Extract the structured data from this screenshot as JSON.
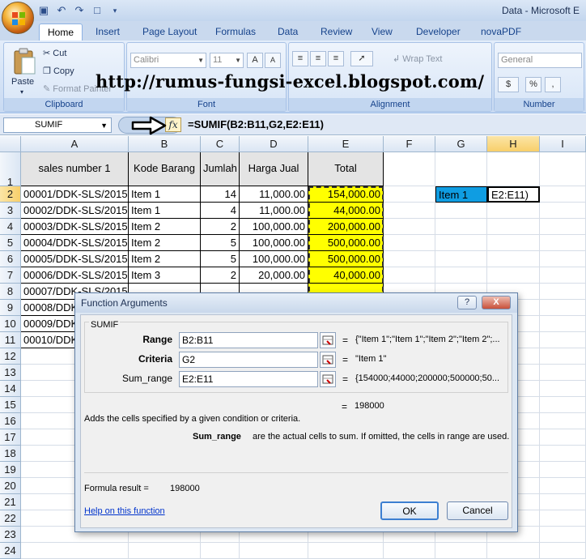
{
  "app": {
    "title": "Data - Microsoft E"
  },
  "quick_access": [
    "save-icon",
    "undo-icon",
    "redo-icon",
    "new-doc-icon"
  ],
  "ribbon": {
    "tabs": [
      "Home",
      "Insert",
      "Page Layout",
      "Formulas",
      "Data",
      "Review",
      "View",
      "Developer",
      "novaPDF"
    ],
    "active_tab": "Home",
    "clipboard": {
      "label": "Clipboard",
      "paste": "Paste",
      "cut": "Cut",
      "copy": "Copy",
      "format_painter": "Format Painter"
    },
    "font": {
      "label": "Font",
      "name": "Calibri",
      "size": "11",
      "grow": "A",
      "shrink": "A"
    },
    "alignment": {
      "label": "Alignment",
      "wrap": "Wrap Text"
    },
    "number": {
      "label": "Number",
      "format": "General",
      "currency": "$",
      "percent": "%",
      "comma": ","
    }
  },
  "watermark": "http://rumus-fungsi-excel.blogspot.com/",
  "formula_bar": {
    "name_box": "SUMIF",
    "fx": "fx",
    "formula": "=SUMIF(B2:B11,G2,E2:E11)"
  },
  "grid": {
    "columns": [
      "A",
      "B",
      "C",
      "D",
      "E",
      "F",
      "G",
      "H",
      "I"
    ],
    "rows": [
      "1",
      "2",
      "3",
      "4",
      "5",
      "6",
      "7",
      "8",
      "9",
      "10",
      "11",
      "12",
      "13",
      "14",
      "15",
      "16",
      "17",
      "18",
      "19",
      "20",
      "21",
      "22",
      "23",
      "24"
    ],
    "headers": {
      "a": "sales number 1",
      "b": "Kode Barang",
      "c": "Jumlah",
      "d": "Harga Jual",
      "e": "Total"
    },
    "data": [
      {
        "a": "00001/DDK-SLS/2015",
        "b": "Item 1",
        "c": "14",
        "d": "11,000.00",
        "e": "154,000.00"
      },
      {
        "a": "00002/DDK-SLS/2015",
        "b": "Item 1",
        "c": "4",
        "d": "11,000.00",
        "e": "44,000.00"
      },
      {
        "a": "00003/DDK-SLS/2015",
        "b": "Item 2",
        "c": "2",
        "d": "100,000.00",
        "e": "200,000.00"
      },
      {
        "a": "00004/DDK-SLS/2015",
        "b": "Item 2",
        "c": "5",
        "d": "100,000.00",
        "e": "500,000.00"
      },
      {
        "a": "00005/DDK-SLS/2015",
        "b": "Item 2",
        "c": "5",
        "d": "100,000.00",
        "e": "500,000.00"
      },
      {
        "a": "00006/DDK-SLS/2015",
        "b": "Item 3",
        "c": "2",
        "d": "20,000.00",
        "e": "40,000.00"
      },
      {
        "a": "00007/DDK-SLS/2015",
        "b": "",
        "c": "",
        "d": "",
        "e": ""
      },
      {
        "a": "00008/DDK",
        "b": "",
        "c": "",
        "d": "",
        "e": ""
      },
      {
        "a": "00009/DDK",
        "b": "",
        "c": "",
        "d": "",
        "e": ""
      },
      {
        "a": "00010/DDK",
        "b": "",
        "c": "",
        "d": "",
        "e": ""
      }
    ],
    "g2": "Item 1",
    "h2": "E2:E11)"
  },
  "dialog": {
    "title": "Function Arguments",
    "function_name": "SUMIF",
    "args": [
      {
        "label": "Range",
        "value": "B2:B11",
        "result": "{\"Item 1\";\"Item 1\";\"Item 2\";\"Item 2\";..."
      },
      {
        "label": "Criteria",
        "value": "G2",
        "result": "\"Item 1\""
      },
      {
        "label": "Sum_range",
        "value": "E2:E11",
        "result": "{154000;44000;200000;500000;50..."
      }
    ],
    "result": "198000",
    "description": "Adds the cells specified by a given condition or criteria.",
    "arg_help_name": "Sum_range",
    "arg_help_text": "are the actual cells to sum. If omitted, the cells in range are used.",
    "formula_result_label": "Formula result =",
    "formula_result_value": "198000",
    "help_link": "Help on this function",
    "ok": "OK",
    "cancel": "Cancel",
    "help_button": "?",
    "close_button": "X"
  }
}
